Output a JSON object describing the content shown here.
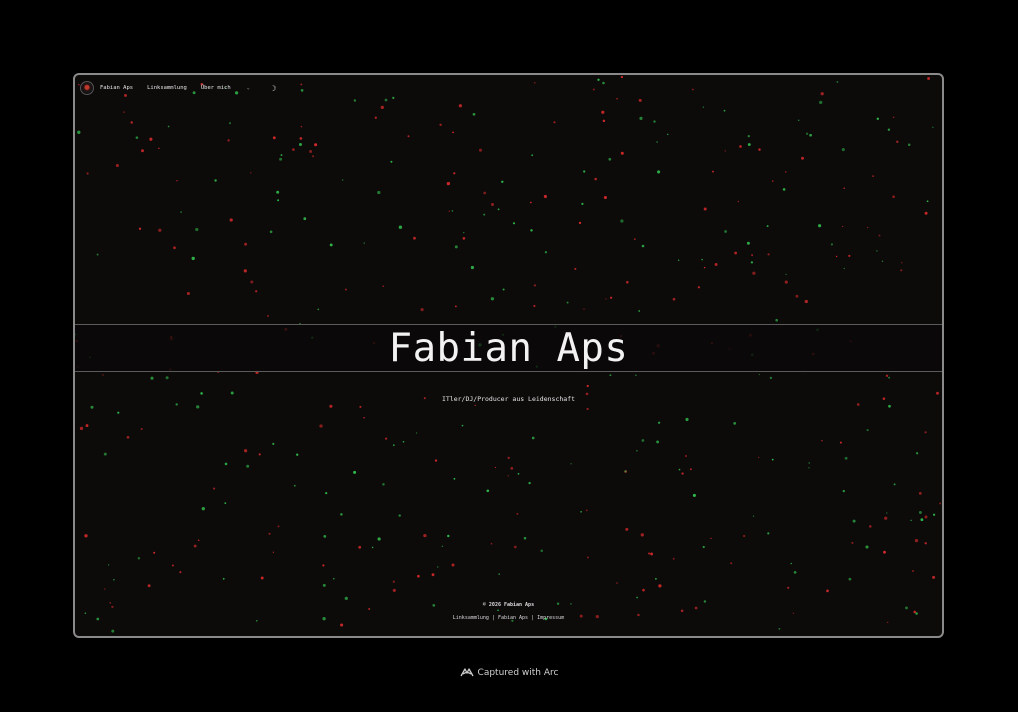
{
  "nav": {
    "brand": "Fabian Aps",
    "links": [
      "Linksammlung",
      "Über mich"
    ],
    "dropdown_chevron": "⌄",
    "theme_icon": "☽"
  },
  "hero": {
    "title": "Fabian Aps",
    "subtitle": "ITler/DJ/Producer aus Leidenschaft"
  },
  "footer": {
    "copyright": "© 2026 Fabian Aps",
    "links": [
      "Linksammlung",
      "Fabian Aps",
      "Impressum"
    ],
    "separators": [
      "|",
      "|"
    ]
  },
  "caption": {
    "text": "Captured with Arc"
  },
  "colors": {
    "background": "#0d0a0a",
    "star_red": "#d42a2a",
    "star_green": "#2fb84a",
    "frame_border": "#8a8a8a"
  }
}
